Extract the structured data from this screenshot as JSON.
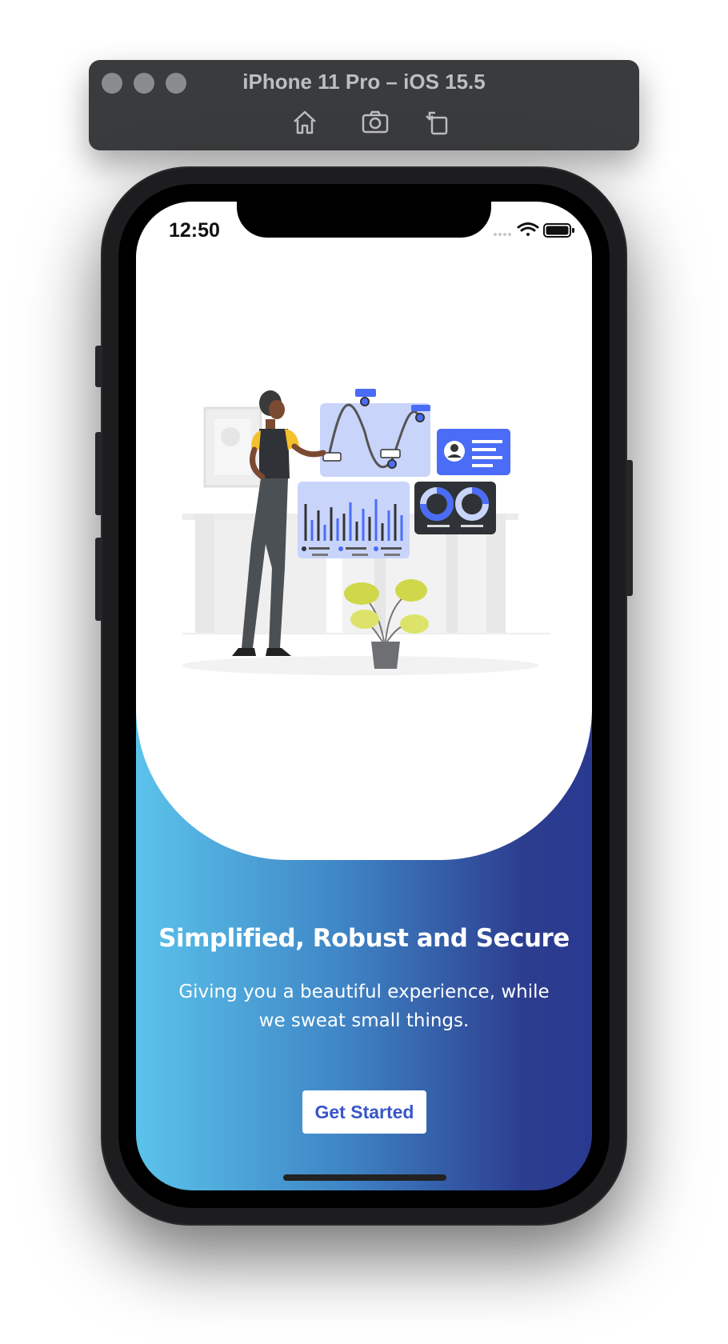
{
  "simulator": {
    "title": "iPhone 11 Pro – iOS 15.5",
    "tools": [
      "home-icon",
      "screenshot-icon",
      "rotate-icon"
    ]
  },
  "status_bar": {
    "time": "12:50",
    "icons": [
      "signal-icon",
      "wifi-icon",
      "battery-icon"
    ]
  },
  "onboarding": {
    "title": "Simplified, Robust and Secure",
    "subtitle": "Giving you a beautiful experience, while we sweat small things.",
    "cta_label": "Get Started"
  },
  "colors": {
    "gradient_start": "#5bc3eb",
    "gradient_end": "#2a3990",
    "button_text": "#3a56c9",
    "illustration_accent": "#4a6cf7",
    "plant": "#cfd84a",
    "person_shirt": "#f4c02e"
  }
}
